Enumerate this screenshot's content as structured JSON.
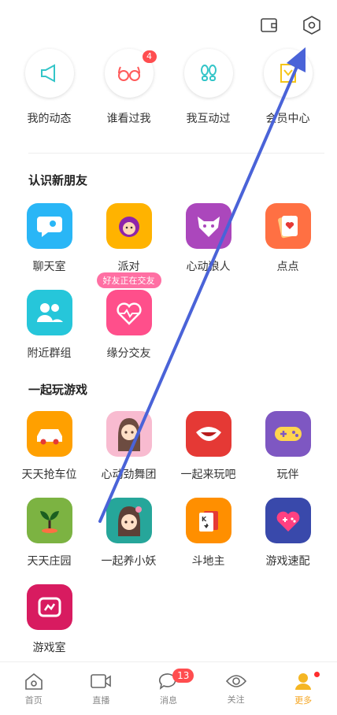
{
  "top_actions": [
    {
      "icon": "wallet-icon"
    },
    {
      "icon": "settings-hex-icon"
    }
  ],
  "quick": [
    {
      "label": "我的动态",
      "icon": "megaphone-icon",
      "color": "#33c5c8"
    },
    {
      "label": "谁看过我",
      "icon": "glasses-icon",
      "color": "#ff5a5a",
      "badge": "4"
    },
    {
      "label": "我互动过",
      "icon": "footprints-icon",
      "color": "#33c5c8"
    },
    {
      "label": "会员中心",
      "icon": "vip-icon",
      "color": "#f5c518"
    }
  ],
  "sections": {
    "friends": {
      "title": "认识新朋友",
      "items": [
        {
          "label": "聊天室",
          "icon": "chat-room-icon",
          "color": "#29b6f6"
        },
        {
          "label": "派对",
          "icon": "party-icon",
          "color": "#ffb300"
        },
        {
          "label": "心动狼人",
          "icon": "wolf-icon",
          "color": "#ab47bc"
        },
        {
          "label": "点点",
          "icon": "cards-heart-icon",
          "color": "#ff7043"
        },
        {
          "label": "附近群组",
          "icon": "group-icon",
          "color": "#26c6da"
        },
        {
          "label": "缘分交友",
          "icon": "heart-icon",
          "color": "#ff4f8b",
          "badge": "好友正在交友"
        }
      ]
    },
    "games": {
      "title": "一起玩游戏",
      "items": [
        {
          "label": "天天抢车位",
          "icon": "car-icon",
          "color": "#ffa000"
        },
        {
          "label": "心动劲舞团",
          "icon": "dancer-icon",
          "color": "#ec407a"
        },
        {
          "label": "一起来玩吧",
          "icon": "mouth-icon",
          "color": "#e53935"
        },
        {
          "label": "玩伴",
          "icon": "gamepad-icon",
          "color": "#7e57c2"
        },
        {
          "label": "天天庄园",
          "icon": "sprout-icon",
          "color": "#7cb342"
        },
        {
          "label": "一起养小妖",
          "icon": "girl-icon",
          "color": "#26a69a"
        },
        {
          "label": "斗地主",
          "icon": "poker-icon",
          "color": "#ff8f00"
        },
        {
          "label": "游戏速配",
          "icon": "heart-gamepad-icon",
          "color": "#3949ab"
        },
        {
          "label": "游戏室",
          "icon": "game-room-icon",
          "color": "#d81b60"
        }
      ]
    }
  },
  "nav": [
    {
      "label": "首页",
      "icon": "home-icon"
    },
    {
      "label": "直播",
      "icon": "video-icon"
    },
    {
      "label": "消息",
      "icon": "message-icon",
      "badge": "13"
    },
    {
      "label": "关注",
      "icon": "eye-icon"
    },
    {
      "label": "更多",
      "icon": "more-icon",
      "active": true,
      "dot": true
    }
  ],
  "colors": {
    "accent": "#f5a623",
    "badge": "#ff4d4f",
    "arrow": "#4a63d8"
  }
}
